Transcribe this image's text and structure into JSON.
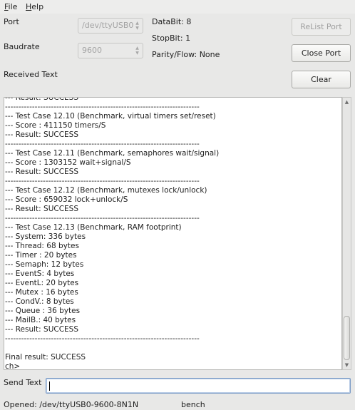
{
  "menu": {
    "file": {
      "mnemonic": "F",
      "rest": "ile"
    },
    "help": {
      "mnemonic": "H",
      "rest": "elp"
    }
  },
  "port": {
    "label": "Port",
    "value": "/dev/ttyUSB0"
  },
  "baudrate": {
    "label": "Baudrate",
    "value": "9600"
  },
  "serial": {
    "databit": "DataBit: 8",
    "stopbit": "StopBit: 1",
    "parity": "Parity/Flow: None"
  },
  "buttons": {
    "relist": "ReList Port",
    "close": "Close Port",
    "clear": "Clear"
  },
  "received": {
    "label": "Received Text",
    "lines": [
      "--- Result: SUCCESS",
      "------------------------------------------------------------------------",
      "--- Test Case 12.10 (Benchmark, virtual timers set/reset)",
      "--- Score : 411150 timers/S",
      "--- Result: SUCCESS",
      "------------------------------------------------------------------------",
      "--- Test Case 12.11 (Benchmark, semaphores wait/signal)",
      "--- Score : 1303152 wait+signal/S",
      "--- Result: SUCCESS",
      "------------------------------------------------------------------------",
      "--- Test Case 12.12 (Benchmark, mutexes lock/unlock)",
      "--- Score : 659032 lock+unlock/S",
      "--- Result: SUCCESS",
      "------------------------------------------------------------------------",
      "--- Test Case 12.13 (Benchmark, RAM footprint)",
      "--- System: 336 bytes",
      "--- Thread: 68 bytes",
      "--- Timer : 20 bytes",
      "--- Semaph: 12 bytes",
      "--- EventS: 4 bytes",
      "--- EventL: 20 bytes",
      "--- Mutex : 16 bytes",
      "--- CondV.: 8 bytes",
      "--- Queue : 36 bytes",
      "--- MailB.: 40 bytes",
      "--- Result: SUCCESS",
      "------------------------------------------------------------------------",
      "",
      "Final result: SUCCESS",
      "ch>"
    ]
  },
  "send": {
    "label": "Send Text",
    "value": ""
  },
  "status": {
    "connection": "Opened: /dev/ttyUSB0-9600-8N1N",
    "message": "bench"
  },
  "colors": {
    "window_bg": "#e8e8e7",
    "input_focus": "#7b9bc6"
  }
}
